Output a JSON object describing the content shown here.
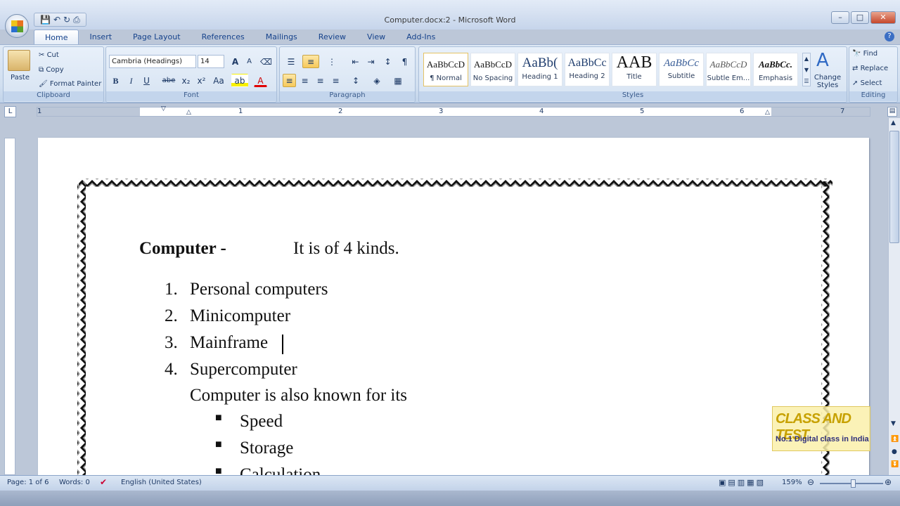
{
  "window": {
    "title": "Computer.docx:2 - Microsoft Word",
    "controls": [
      "–",
      "□",
      "✕"
    ]
  },
  "tabs": [
    "Home",
    "Insert",
    "Page Layout",
    "References",
    "Mailings",
    "Review",
    "View",
    "Add-Ins"
  ],
  "ribbon": {
    "clipboard": {
      "label": "Clipboard",
      "paste": "Paste",
      "cut": "Cut",
      "copy": "Copy",
      "format_painter": "Format Painter"
    },
    "font": {
      "label": "Font",
      "font_name": "Cambria (Headings)",
      "font_size": "14",
      "grow": "A",
      "shrink": "A",
      "bold": "B",
      "italic": "I",
      "underline": "U",
      "strike": "abe",
      "subscript": "x₂",
      "superscript": "x²",
      "change_case": "Aa",
      "highlight": "ab",
      "font_color": "A"
    },
    "paragraph": {
      "label": "Paragraph",
      "show_marks": "¶"
    },
    "styles": {
      "label": "Styles",
      "items": [
        {
          "preview": "AaBbCcD",
          "name": "¶ Normal"
        },
        {
          "preview": "AaBbCcD",
          "name": "No Spacing"
        },
        {
          "preview": "AaBb(",
          "name": "Heading 1"
        },
        {
          "preview": "AaBbCc",
          "name": "Heading 2"
        },
        {
          "preview": "AAB",
          "name": "Title"
        },
        {
          "preview": "AaBbCc",
          "name": "Subtitle"
        },
        {
          "preview": "AaBbCcD",
          "name": "Subtle Em..."
        },
        {
          "preview": "AaBbCc.",
          "name": "Emphasis"
        }
      ],
      "change_styles": "Change Styles"
    },
    "editing": {
      "label": "Editing",
      "find": "Find",
      "replace": "Replace",
      "select": "Select"
    }
  },
  "ruler": {
    "numbers": [
      "1",
      "1",
      "2",
      "3",
      "4",
      "5",
      "6",
      "7"
    ]
  },
  "document": {
    "heading_bold": "Computer  -",
    "heading_rest": "It is of 4 kinds.",
    "numbered": [
      {
        "num": "1.",
        "text": "Personal computers"
      },
      {
        "num": "2.",
        "text": "Minicomputer"
      },
      {
        "num": "3.",
        "text": "Mainframe"
      },
      {
        "num": "4.",
        "text": "Supercomputer"
      }
    ],
    "paragraph": "Computer is also known for its",
    "bullets": [
      "Speed",
      "Storage",
      "Calculation"
    ]
  },
  "watermark": {
    "line1": "CLASS AND TEST",
    "line2": "No.1 Digital class in India"
  },
  "status": {
    "page": "Page: 1 of 6",
    "words": "Words: 0",
    "language": "English (United States)",
    "zoom": "159%"
  },
  "colors": {
    "accent": "#15428b",
    "ribbon_bg": "#d1dff0",
    "border_dark": "#111111"
  }
}
